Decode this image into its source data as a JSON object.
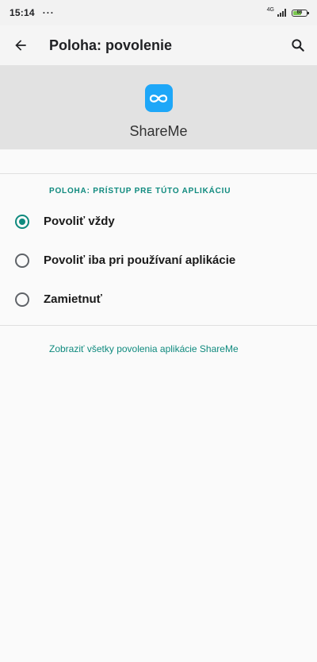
{
  "status_bar": {
    "time": "15:14",
    "dots": "···",
    "network": "4G",
    "battery_level": "66",
    "battery_fraction": 0.66
  },
  "app_bar": {
    "title": "Poloha: povolenie",
    "back_icon": "arrow-left-icon",
    "search_icon": "search-icon"
  },
  "app": {
    "name": "ShareMe",
    "icon": "infinity-loop-icon",
    "icon_color": "#1ea7f8"
  },
  "section": {
    "label": "POLOHA: PRÍSTUP PRE TÚTO APLIKÁCIU"
  },
  "options": [
    {
      "label": "Povoliť vždy",
      "checked": true
    },
    {
      "label": "Povoliť iba pri používaní aplikácie",
      "checked": false
    },
    {
      "label": "Zamietnuť",
      "checked": false
    }
  ],
  "link": {
    "label": "Zobraziť všetky povolenia aplikácie ShareMe"
  },
  "colors": {
    "accent": "#0f8a7e",
    "header_bg": "#e2e2e2"
  }
}
